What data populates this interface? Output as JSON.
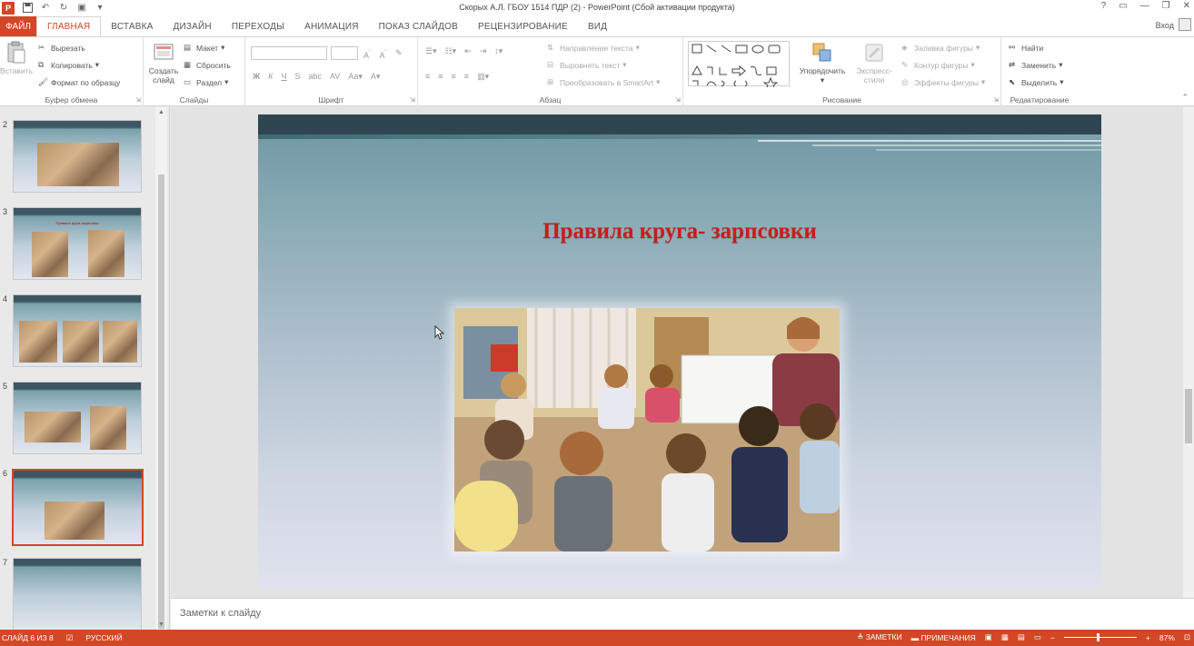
{
  "window": {
    "title": "Скорых А.Л. ГБОУ 1514 ПДР (2) - PowerPoint (Сбой активации продукта)",
    "signin": "Вход"
  },
  "tabs": [
    {
      "label": "ФАЙЛ"
    },
    {
      "label": "ГЛАВНАЯ"
    },
    {
      "label": "ВСТАВКА"
    },
    {
      "label": "ДИЗАЙН"
    },
    {
      "label": "ПЕРЕХОДЫ"
    },
    {
      "label": "АНИМАЦИЯ"
    },
    {
      "label": "ПОКАЗ СЛАЙДОВ"
    },
    {
      "label": "РЕЦЕНЗИРОВАНИЕ"
    },
    {
      "label": "ВИД"
    }
  ],
  "ribbon": {
    "clipboard": {
      "label": "Буфер обмена",
      "paste": "Вставить",
      "cut": "Вырезать",
      "copy": "Копировать",
      "format_painter": "Формат по образцу"
    },
    "slides": {
      "label": "Слайды",
      "new_slide_line1": "Создать",
      "new_slide_line2": "слайд",
      "layout": "Макет",
      "reset": "Сбросить",
      "section": "Раздел"
    },
    "font": {
      "label": "Шрифт",
      "buttons": [
        "Ж",
        "К",
        "Ч",
        "S",
        "abc"
      ]
    },
    "paragraph": {
      "label": "Абзац",
      "text_direction": "Направление текста",
      "align_text": "Выровнять текст",
      "smartart": "Преобразовать в SmartArt"
    },
    "drawing": {
      "label": "Рисование",
      "arrange": "Упорядочить",
      "quick_styles_line1": "Экспресс-",
      "quick_styles_line2": "стили",
      "shape_fill": "Заливка фигуры",
      "shape_outline": "Контур фигуры",
      "shape_effects": "Эффекты фигуры"
    },
    "editing": {
      "label": "Редактирование",
      "find": "Найти",
      "replace": "Заменить",
      "select": "Выделить"
    }
  },
  "thumbnails": [
    {
      "num": "2",
      "title": ""
    },
    {
      "num": "3",
      "title": "Правила круга-зарисовки"
    },
    {
      "num": "4",
      "title": ""
    },
    {
      "num": "5",
      "title": ""
    },
    {
      "num": "6",
      "title": "",
      "active": true
    },
    {
      "num": "7",
      "title": ""
    }
  ],
  "slide": {
    "title": "Правила круга- зарпсовки"
  },
  "notes": {
    "placeholder": "Заметки к слайду"
  },
  "status": {
    "slide_info": "СЛАЙД 6 ИЗ 8",
    "language": "РУССКИЙ",
    "notes": "ЗАМЕТКИ",
    "comments": "ПРИМЕЧАНИЯ",
    "zoom": "87%"
  },
  "colors": {
    "accent": "#d24726",
    "title_red": "#cc1b1b"
  }
}
